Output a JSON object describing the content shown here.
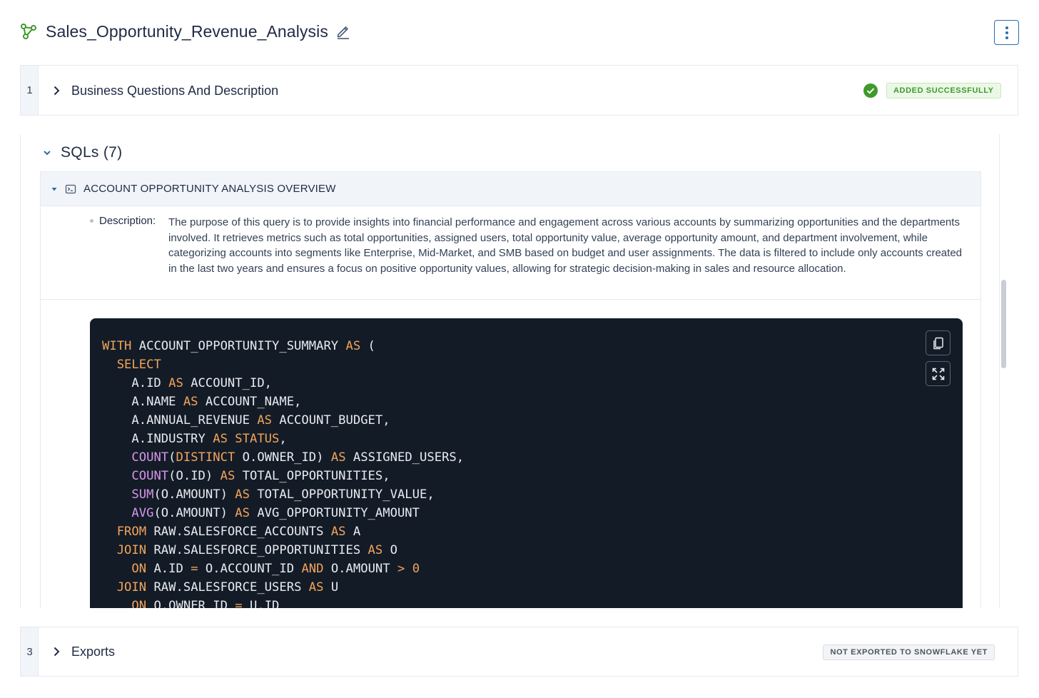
{
  "header": {
    "title": "Sales_Opportunity_Revenue_Analysis",
    "app_icon": "graph-nodes-icon",
    "edit_icon": "pencil-icon",
    "menu_icon": "kebab-menu-icon"
  },
  "sections": [
    {
      "step": "1",
      "title": "Business Questions And Description",
      "status": "ADDED SUCCESSFULLY",
      "status_icon": "check-circle-icon",
      "status_color": "#3f9a2b"
    },
    {
      "step": "3",
      "title": "Exports",
      "status": "NOT EXPORTED TO SNOWFLAKE YET"
    }
  ],
  "sqls": {
    "heading": "SQLs",
    "count": "(7)",
    "card": {
      "name": "ACCOUNT OPPORTUNITY ANALYSIS OVERVIEW",
      "description_label": "Description:",
      "description": "The purpose of this query is to provide insights into financial performance and engagement across various accounts by summarizing opportunities and the departments involved. It retrieves metrics such as total opportunities, assigned users, total opportunity value, average opportunity amount, and department involvement, while categorizing accounts into segments like Enterprise, Mid-Market, and SMB based on budget and user assignments. The data is filtered to include only accounts created in the last two years and ensures a focus on positive opportunity values, allowing for strategic decision-making in sales and resource allocation.",
      "code_lines": [
        [
          [
            "kw",
            "WITH"
          ],
          [
            "t",
            " ACCOUNT_OPPORTUNITY_SUMMARY "
          ],
          [
            "kw",
            "AS"
          ],
          [
            "t",
            " ("
          ]
        ],
        [
          [
            "t",
            "  "
          ],
          [
            "kw",
            "SELECT"
          ]
        ],
        [
          [
            "t",
            "    A.ID "
          ],
          [
            "kw",
            "AS"
          ],
          [
            "t",
            " ACCOUNT_ID,"
          ]
        ],
        [
          [
            "t",
            "    A.NAME "
          ],
          [
            "kw",
            "AS"
          ],
          [
            "t",
            " ACCOUNT_NAME,"
          ]
        ],
        [
          [
            "t",
            "    A.ANNUAL_REVENUE "
          ],
          [
            "kw",
            "AS"
          ],
          [
            "t",
            " ACCOUNT_BUDGET,"
          ]
        ],
        [
          [
            "t",
            "    A.INDUSTRY "
          ],
          [
            "kw",
            "AS"
          ],
          [
            "t",
            " "
          ],
          [
            "kw",
            "STATUS"
          ],
          [
            "t",
            ","
          ]
        ],
        [
          [
            "t",
            "    "
          ],
          [
            "fn",
            "COUNT"
          ],
          [
            "t",
            "("
          ],
          [
            "kw",
            "DISTINCT"
          ],
          [
            "t",
            " O.OWNER_ID) "
          ],
          [
            "kw",
            "AS"
          ],
          [
            "t",
            " ASSIGNED_USERS,"
          ]
        ],
        [
          [
            "t",
            "    "
          ],
          [
            "fn",
            "COUNT"
          ],
          [
            "t",
            "(O.ID) "
          ],
          [
            "kw",
            "AS"
          ],
          [
            "t",
            " TOTAL_OPPORTUNITIES,"
          ]
        ],
        [
          [
            "t",
            "    "
          ],
          [
            "fn",
            "SUM"
          ],
          [
            "t",
            "(O.AMOUNT) "
          ],
          [
            "kw",
            "AS"
          ],
          [
            "t",
            " TOTAL_OPPORTUNITY_VALUE,"
          ]
        ],
        [
          [
            "t",
            "    "
          ],
          [
            "fn",
            "AVG"
          ],
          [
            "t",
            "(O.AMOUNT) "
          ],
          [
            "kw",
            "AS"
          ],
          [
            "t",
            " AVG_OPPORTUNITY_AMOUNT"
          ]
        ],
        [
          [
            "t",
            "  "
          ],
          [
            "kw",
            "FROM"
          ],
          [
            "t",
            " RAW.SALESFORCE_ACCOUNTS "
          ],
          [
            "kw",
            "AS"
          ],
          [
            "t",
            " A"
          ]
        ],
        [
          [
            "t",
            "  "
          ],
          [
            "kw",
            "JOIN"
          ],
          [
            "t",
            " RAW.SALESFORCE_OPPORTUNITIES "
          ],
          [
            "kw",
            "AS"
          ],
          [
            "t",
            " O"
          ]
        ],
        [
          [
            "t",
            "    "
          ],
          [
            "kw",
            "ON"
          ],
          [
            "t",
            " A.ID "
          ],
          [
            "kw",
            "="
          ],
          [
            "t",
            " O.ACCOUNT_ID "
          ],
          [
            "kw",
            "AND"
          ],
          [
            "t",
            " O.AMOUNT "
          ],
          [
            "kw",
            ">"
          ],
          [
            "t",
            " "
          ],
          [
            "kw",
            "0"
          ]
        ],
        [
          [
            "t",
            "  "
          ],
          [
            "kw",
            "JOIN"
          ],
          [
            "t",
            " RAW.SALESFORCE_USERS "
          ],
          [
            "kw",
            "AS"
          ],
          [
            "t",
            " U"
          ]
        ],
        [
          [
            "t",
            "    "
          ],
          [
            "kw",
            "ON"
          ],
          [
            "t",
            " O.OWNER_ID "
          ],
          [
            "kw",
            "="
          ],
          [
            "t",
            " U.ID"
          ]
        ]
      ],
      "copy_icon": "copy-icon",
      "expand_icon": "expand-icon"
    }
  },
  "colors": {
    "keyword": "#f2a45a",
    "function": "#d496e8",
    "code_bg": "#131b27",
    "accent": "#2b6cb0"
  }
}
